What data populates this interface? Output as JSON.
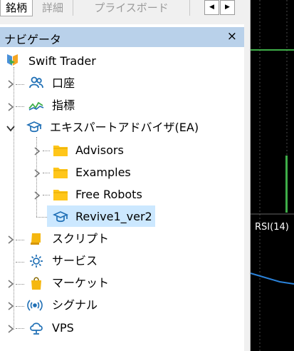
{
  "tabs": [
    {
      "label": "銘柄",
      "active": true
    },
    {
      "label": "詳細",
      "active": false
    },
    {
      "label": "プライスボード",
      "active": false
    }
  ],
  "tab_scroll": {
    "left": "◀",
    "right": "▶"
  },
  "navigator": {
    "title": "ナビゲータ",
    "close": "×",
    "root": "Swift Trader",
    "items": [
      {
        "label": "口座",
        "icon": "accounts-icon"
      },
      {
        "label": "指標",
        "icon": "indicators-icon"
      },
      {
        "label": "エキスパートアドバイザ(EA)",
        "icon": "expert-advisors-icon"
      },
      {
        "label": "スクリプト",
        "icon": "scripts-icon"
      },
      {
        "label": "サービス",
        "icon": "services-icon"
      },
      {
        "label": "マーケット",
        "icon": "market-icon"
      },
      {
        "label": "シグナル",
        "icon": "signals-icon"
      },
      {
        "label": "VPS",
        "icon": "vps-icon"
      }
    ],
    "ea_children": [
      {
        "label": "Advisors",
        "icon": "folder-icon"
      },
      {
        "label": "Examples",
        "icon": "folder-icon"
      },
      {
        "label": "Free Robots",
        "icon": "folder-icon"
      },
      {
        "label": "Revive1_ver2",
        "icon": "expert-advisor-icon",
        "selected": true
      }
    ]
  },
  "chart": {
    "indicator_label": "RSI(14)"
  },
  "colors": {
    "header": "#b9d1ea",
    "selection": "#cce8ff",
    "folder": "#ffc61a",
    "icon_blue": "#1f6fb5"
  }
}
